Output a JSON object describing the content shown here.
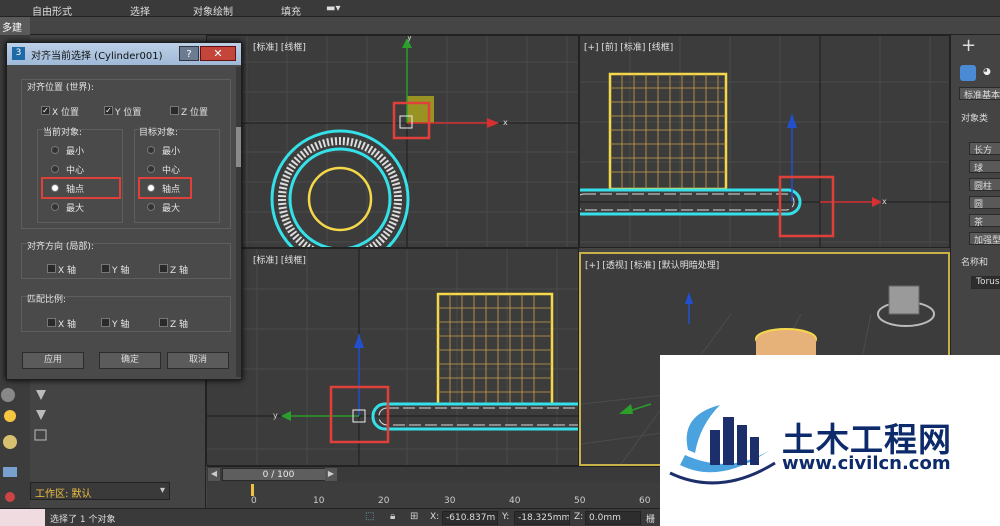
{
  "menu": {
    "items": [
      "自由形式",
      "选择",
      "对象绘制",
      "填充"
    ]
  },
  "tabs": {
    "active": "多建模"
  },
  "viewports": {
    "top_label": "[标准] [线框]",
    "front_label": "[+] [前] [标准] [线框]",
    "left_label": "[标准] [线框]",
    "persp_label": "[+] [透视] [标准] [默认明暗处理]"
  },
  "dialog": {
    "title": "对齐当前选择 (Cylinder001)",
    "icon": "3",
    "help": "?",
    "close": "✕",
    "align_position_label": "对齐位置 (世界):",
    "x_pos": "X 位置",
    "y_pos": "Y 位置",
    "z_pos": "Z 位置",
    "current_object_label": "当前对象:",
    "target_object_label": "目标对象:",
    "options": [
      "最小",
      "中心",
      "轴点",
      "最大"
    ],
    "align_orientation_label": "对齐方向 (局部):",
    "x_axis": "X 轴",
    "y_axis": "Y 轴",
    "z_axis": "Z 轴",
    "match_scale_label": "匹配比例:",
    "apply": "应用",
    "ok": "确定",
    "cancel": "取消"
  },
  "right_panel": {
    "plus": "+",
    "dropdown": "标准基本",
    "section1": "对象类",
    "buttons": [
      "长方",
      "球",
      "圆柱",
      "圆",
      "茶",
      "加强型"
    ],
    "section2": "名称和",
    "name_field": "TorusC"
  },
  "timeline": {
    "frame": "0 / 100",
    "ticks": [
      "0",
      "10",
      "20",
      "30",
      "40",
      "50",
      "60"
    ]
  },
  "workzone": {
    "label": "工作区: 默认"
  },
  "status": {
    "message": "选择了 1 个对象",
    "x_label": "X:",
    "x_value": "-610.837m",
    "y_label": "Y:",
    "y_value": "-18.325mm",
    "z_label": "Z:",
    "z_value": "0.0mm",
    "right_text": "栅"
  },
  "watermark": {
    "title": "土木工程网",
    "url": "www.civilcn.com"
  },
  "colors": {
    "cyan": "#35e0e8",
    "yellow": "#f5d84a",
    "red_highlight": "#e0403a",
    "viewport_bg": "#3c3c3c"
  }
}
